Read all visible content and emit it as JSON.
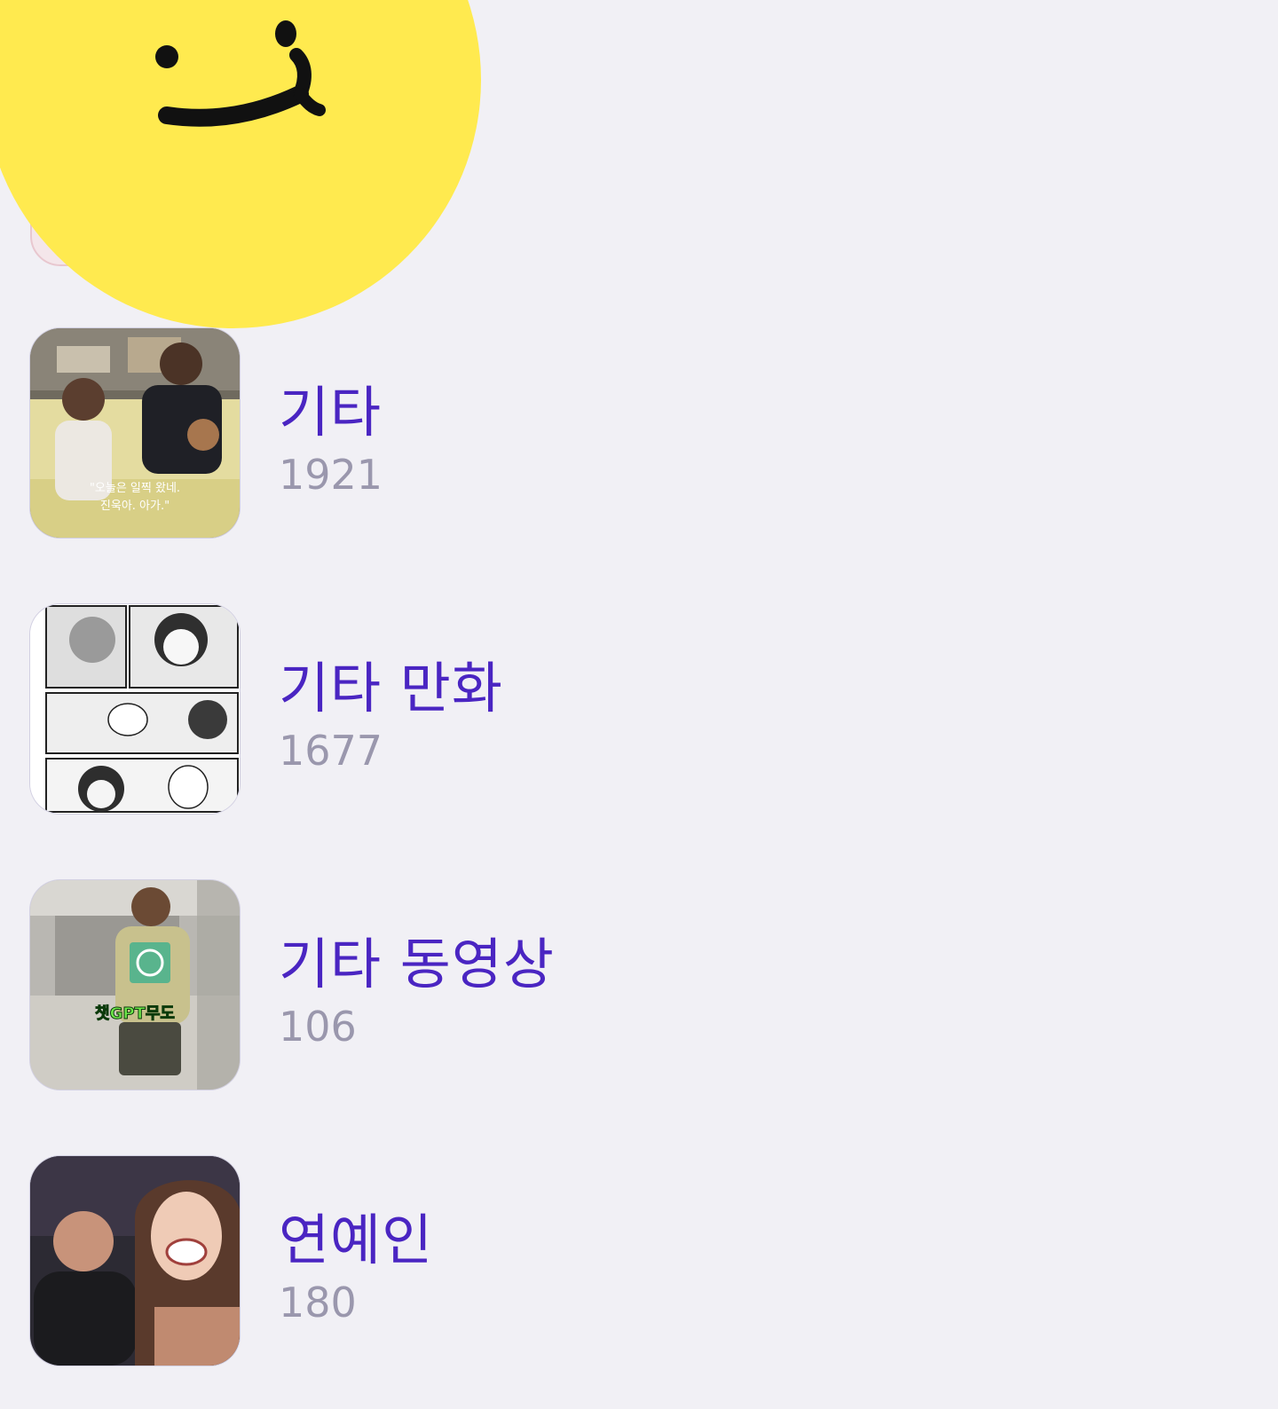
{
  "albums": [
    {
      "title": "기타",
      "count": "1921",
      "thumb_icon": "photo-thumbnail"
    },
    {
      "title": "기타 만화",
      "count": "1677",
      "thumb_icon": "comic-thumbnail"
    },
    {
      "title": "기타 동영상",
      "count": "106",
      "thumb_icon": "video-thumbnail",
      "thumb_caption": "챗GPT무도"
    },
    {
      "title": "연예인",
      "count": "180",
      "thumb_icon": "photo-thumbnail"
    }
  ],
  "thumb_texts": {
    "family_caption_1": "\"오늘은 일찍 왔네.",
    "family_caption_2": "진욱아. 아가.\""
  },
  "colors": {
    "background": "#f1f0f5",
    "title": "#4a25c2",
    "count": "#9a97ad",
    "smiley": "#ffea4f"
  }
}
